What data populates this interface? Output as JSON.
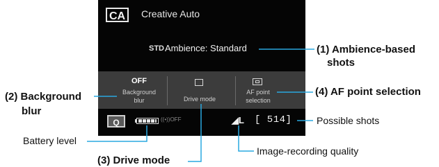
{
  "screen": {
    "mode_badge": "CA",
    "mode_label": "Creative Auto",
    "ambience_icon": "STD",
    "ambience_text": "Ambience: Standard",
    "bg_blur_value": "OFF",
    "bg_blur_label": "Background blur",
    "drive_label": "Drive mode",
    "af_label": "AF point selection",
    "q_button": "Q",
    "wifi_text": "((•))OFF",
    "quality_text": "◢L",
    "shots_text": "[ 514]"
  },
  "callouts": {
    "c1_line1": "(1) Ambience-based",
    "c1_line2": "shots",
    "c2_line1": "(2) Background",
    "c2_line2": "blur",
    "c3": "(3) Drive mode",
    "c4": "(4) AF point selection",
    "battery": "Battery level",
    "possible": "Possible shots",
    "quality": "Image-recording quality"
  },
  "colors": {
    "leader": "#29a8e0",
    "screen": "#050505",
    "panel": "#3c3c3c"
  }
}
